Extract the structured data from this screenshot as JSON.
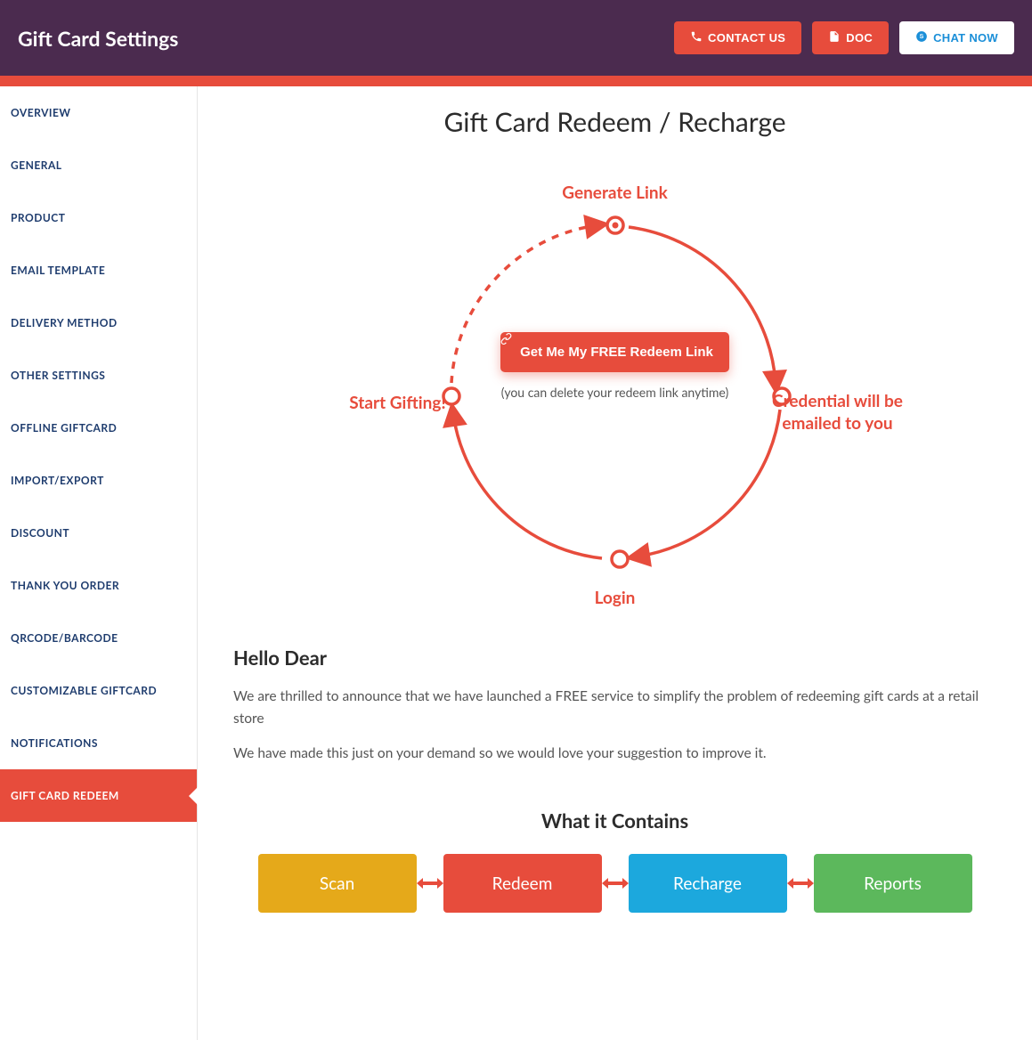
{
  "header": {
    "title": "Gift Card Settings",
    "contact": "CONTACT US",
    "doc": "DOC",
    "chat": "CHAT NOW"
  },
  "sidebar": {
    "items": [
      {
        "label": "OVERVIEW",
        "active": false
      },
      {
        "label": "GENERAL",
        "active": false
      },
      {
        "label": "PRODUCT",
        "active": false
      },
      {
        "label": "EMAIL TEMPLATE",
        "active": false
      },
      {
        "label": "DELIVERY METHOD",
        "active": false
      },
      {
        "label": "OTHER SETTINGS",
        "active": false
      },
      {
        "label": "OFFLINE GIFTCARD",
        "active": false
      },
      {
        "label": "IMPORT/EXPORT",
        "active": false
      },
      {
        "label": "DISCOUNT",
        "active": false
      },
      {
        "label": "THANK YOU ORDER",
        "active": false
      },
      {
        "label": "QRCODE/BARCODE",
        "active": false
      },
      {
        "label": "CUSTOMIZABLE GIFTCARD",
        "active": false
      },
      {
        "label": "NOTIFICATIONS",
        "active": false
      },
      {
        "label": "GIFT CARD REDEEM",
        "active": true
      }
    ]
  },
  "main": {
    "title": "Gift Card Redeem / Recharge",
    "diagram": {
      "top": "Generate Link",
      "right": "Credential will be emailed to you",
      "bottom": "Login",
      "left": "Start Gifting!",
      "button": "Get Me My FREE Redeem Link",
      "sub": "(you can delete your redeem link anytime)"
    },
    "hello": "Hello Dear",
    "p1": "We are thrilled to announce that we have launched a FREE service to simplify the problem of redeeming gift cards at a retail store",
    "p2": "We have made this just on your demand so we would love your suggestion to improve it.",
    "contains_title": "What it Contains",
    "tiles": [
      "Scan",
      "Redeem",
      "Recharge",
      "Reports"
    ]
  },
  "colors": {
    "brand_purple": "#4b2b4f",
    "accent_red": "#e74c3c",
    "tile_yellow": "#e5a91a",
    "tile_blue": "#1ca8dd",
    "tile_green": "#5cb85c"
  }
}
